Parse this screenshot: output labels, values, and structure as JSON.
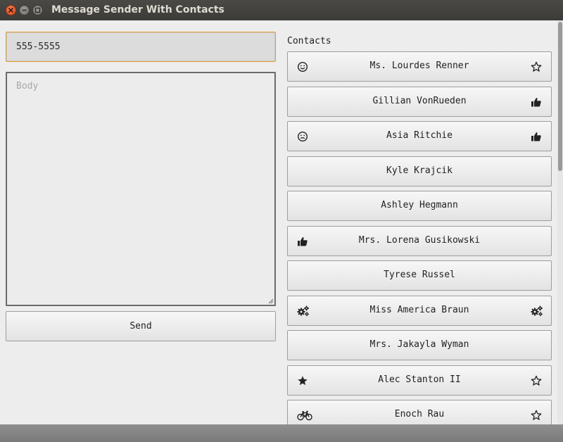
{
  "window": {
    "title": "Message Sender With Contacts"
  },
  "phone": {
    "value": "555-5555"
  },
  "body": {
    "placeholder": "Body",
    "value": ""
  },
  "send": {
    "label": "Send"
  },
  "contacts": {
    "label": "Contacts",
    "items": [
      {
        "name": "Ms. Lourdes Renner",
        "left_icon": "smile-icon",
        "right_icon": "star-outline-icon"
      },
      {
        "name": "Gillian VonRueden",
        "left_icon": "",
        "right_icon": "thumbs-up-icon"
      },
      {
        "name": "Asia Ritchie",
        "left_icon": "neutral-face-icon",
        "right_icon": "thumbs-up-icon"
      },
      {
        "name": "Kyle Krajcik",
        "left_icon": "",
        "right_icon": ""
      },
      {
        "name": "Ashley Hegmann",
        "left_icon": "",
        "right_icon": ""
      },
      {
        "name": "Mrs. Lorena Gusikowski",
        "left_icon": "thumbs-up-icon",
        "right_icon": ""
      },
      {
        "name": "Tyrese Russel",
        "left_icon": "",
        "right_icon": ""
      },
      {
        "name": "Miss America Braun",
        "left_icon": "gears-icon",
        "right_icon": "gears-icon"
      },
      {
        "name": "Mrs. Jakayla Wyman",
        "left_icon": "",
        "right_icon": ""
      },
      {
        "name": "Alec Stanton II",
        "left_icon": "star-filled-icon",
        "right_icon": "star-outline-icon"
      },
      {
        "name": "Enoch Rau",
        "left_icon": "bicycle-icon",
        "right_icon": "star-outline-icon"
      }
    ]
  }
}
